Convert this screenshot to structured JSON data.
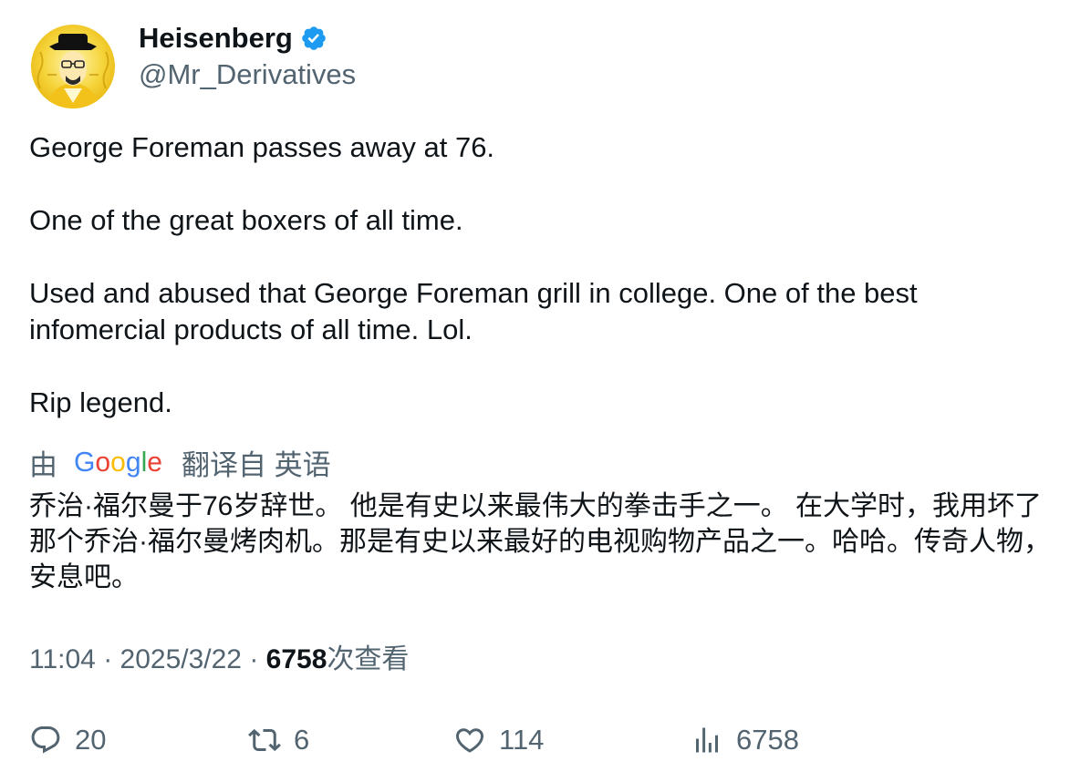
{
  "user": {
    "name": "Heisenberg",
    "handle": "@Mr_Derivatives",
    "verified_color": "#1d9bf0"
  },
  "tweet": {
    "p1": "George Foreman passes away at 76.",
    "p2": "One of the great boxers of all time.",
    "p3": "Used and abused that George Foreman grill in college. One of the best infomercial products of all time. Lol.",
    "p4": "Rip legend."
  },
  "translation": {
    "by": "由",
    "provider": "Google",
    "from_label": "翻译自 英语",
    "text": "乔治·福尔曼于76岁辞世。 他是有史以来最伟大的拳击手之一。 在大学时，我用坏了那个乔治·福尔曼烤肉机。那是有史以来最好的电视购物产品之一。哈哈。传奇人物，安息吧。"
  },
  "meta": {
    "time": "11:04",
    "sep1": " · ",
    "date": "2025/3/22",
    "sep2": " · ",
    "views": "6758",
    "views_label": "次查看"
  },
  "actions": {
    "replies": "20",
    "reposts": "6",
    "likes": "114",
    "views": "6758"
  },
  "icons": [
    "verified-badge-icon",
    "reply-icon",
    "repost-icon",
    "like-icon",
    "views-icon",
    "google-logo"
  ]
}
